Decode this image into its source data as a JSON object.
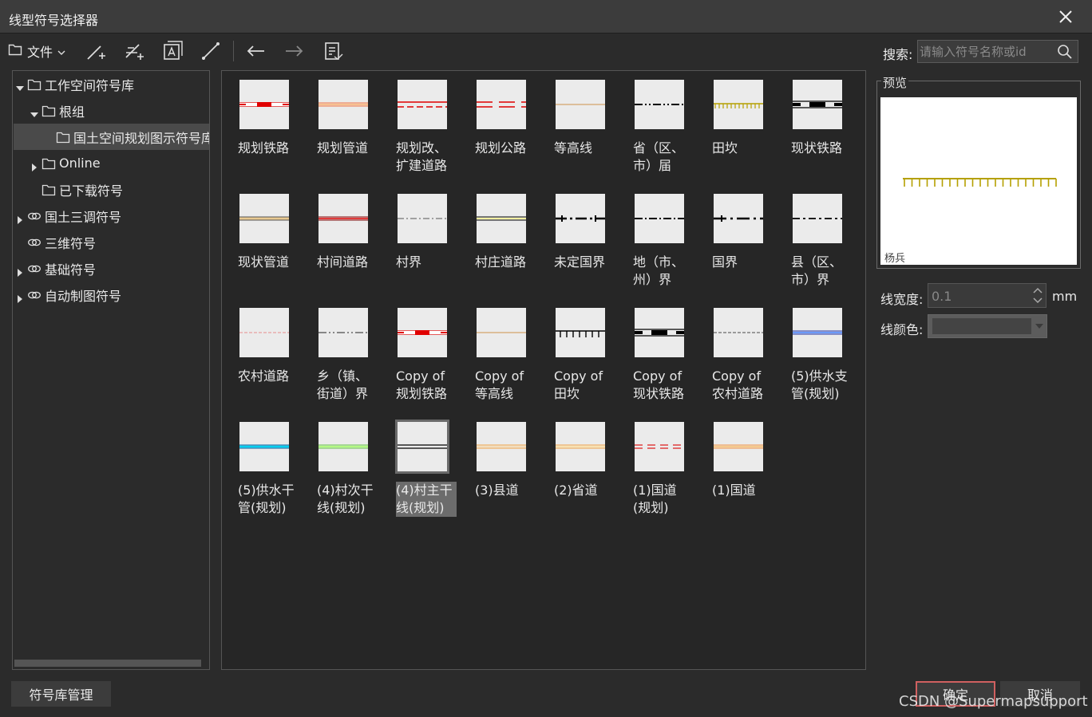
{
  "window": {
    "title": "线型符号选择器"
  },
  "toolbar": {
    "file_label": "文件",
    "search_label": "搜索:",
    "search_placeholder": "请输入符号名称或id"
  },
  "tree": [
    {
      "label": "工作空间符号库",
      "icon": "folder-icon",
      "arrow": "expanded",
      "indent": 0
    },
    {
      "label": "根组",
      "icon": "folder-icon",
      "arrow": "expanded",
      "indent": 1
    },
    {
      "label": "国土空间规划图示符号库",
      "icon": "folder-icon",
      "arrow": "none",
      "indent": 2,
      "selected": true
    },
    {
      "label": "Online",
      "icon": "folder-icon",
      "arrow": "collapsed",
      "indent": 1
    },
    {
      "label": "已下载符号",
      "icon": "folder-icon",
      "arrow": "none",
      "indent": 1
    },
    {
      "label": "国土三调符号",
      "icon": "link-icon",
      "arrow": "collapsed",
      "indent": 0
    },
    {
      "label": "三维符号",
      "icon": "link-icon",
      "arrow": "none",
      "indent": 0
    },
    {
      "label": "基础符号",
      "icon": "link-icon",
      "arrow": "collapsed",
      "indent": 0
    },
    {
      "label": "自动制图符号",
      "icon": "link-icon",
      "arrow": "collapsed",
      "indent": 0
    }
  ],
  "symbols": [
    {
      "label": "规划铁路",
      "style": "rail-red"
    },
    {
      "label": "规划管道",
      "style": "pipe-orange"
    },
    {
      "label": "规划改、扩建道路",
      "style": "road-red-dash"
    },
    {
      "label": "规划公路",
      "style": "highway-red"
    },
    {
      "label": "等高线",
      "style": "contour"
    },
    {
      "label": "省（区、市）届",
      "style": "prov-border"
    },
    {
      "label": "田坎",
      "style": "field-ridge"
    },
    {
      "label": "现状铁路",
      "style": "rail-black"
    },
    {
      "label": "现状管道",
      "style": "pipe-tan"
    },
    {
      "label": "村间道路",
      "style": "road-darkred"
    },
    {
      "label": "村界",
      "style": "village-border"
    },
    {
      "label": "村庄道路",
      "style": "village-road"
    },
    {
      "label": "未定国界",
      "style": "undef-border"
    },
    {
      "label": "地（市、州）界",
      "style": "city-border"
    },
    {
      "label": "国界",
      "style": "national-border"
    },
    {
      "label": "县（区、市）界",
      "style": "county-border"
    },
    {
      "label": "农村道路",
      "style": "rural-road"
    },
    {
      "label": "乡（镇、街道）界",
      "style": "town-border"
    },
    {
      "label": "Copy of 规划铁路",
      "style": "rail-red"
    },
    {
      "label": "Copy of 等高线",
      "style": "contour"
    },
    {
      "label": "Copy of 田坎",
      "style": "field-ridge-black"
    },
    {
      "label": "Copy of 现状铁路",
      "style": "rail-black"
    },
    {
      "label": "Copy of 农村道路",
      "style": "rural-road-gray"
    },
    {
      "label": "(5)供水支管(规划)",
      "style": "water-blue"
    },
    {
      "label": "(5)供水干管(规划)",
      "style": "water-cyan"
    },
    {
      "label": "(4)村次干线(规划)",
      "style": "green-line"
    },
    {
      "label": "(4)村主干线(规划)",
      "style": "double-black",
      "selected": true
    },
    {
      "label": "(3)县道",
      "style": "county-road"
    },
    {
      "label": "(2)省道",
      "style": "prov-road"
    },
    {
      "label": "(1)国道(规划)",
      "style": "national-road-plan"
    },
    {
      "label": "(1)国道",
      "style": "national-road"
    }
  ],
  "preview": {
    "group_label": "预览",
    "caption": "杨兵",
    "line_color": "#b5a000"
  },
  "props": {
    "width_label": "线宽度:",
    "width_value": "0.1",
    "width_unit": "mm",
    "color_label": "线颜色:"
  },
  "buttons": {
    "manage": "符号库管理",
    "ok": "确定",
    "cancel": "取消"
  },
  "watermark": "CSDN @Supermapsupport"
}
